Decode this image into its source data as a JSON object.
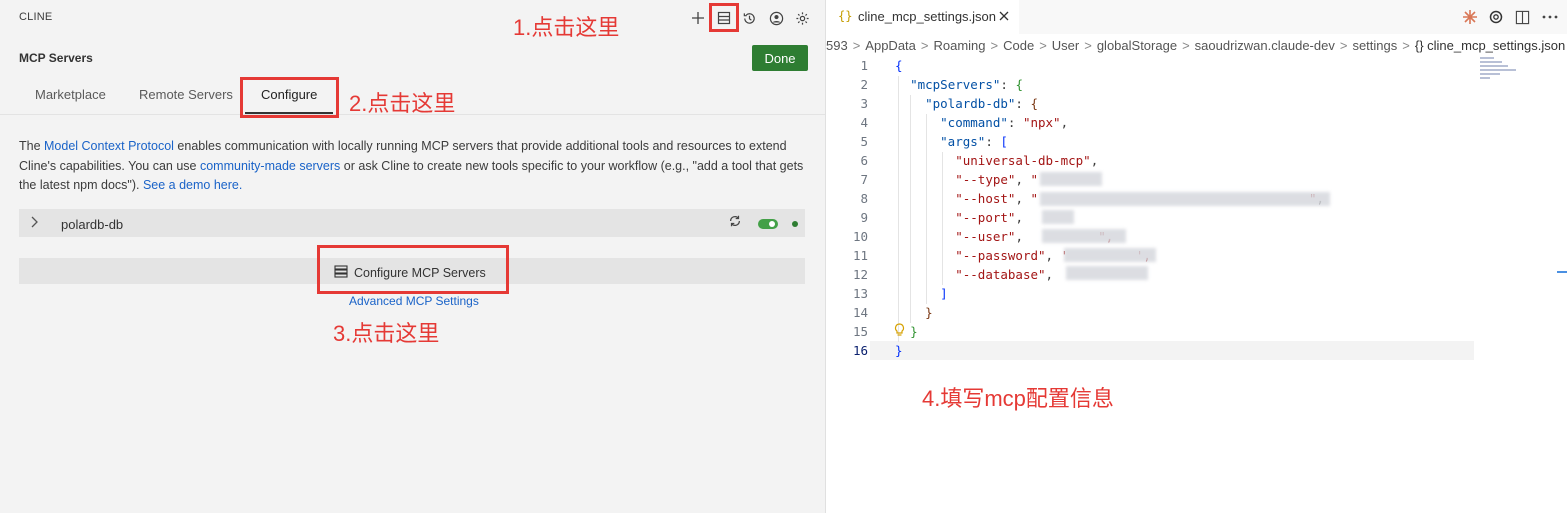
{
  "left_panel": {
    "app_title": "CLINE",
    "section_title": "MCP Servers",
    "done_label": "Done",
    "tabs": [
      {
        "label": "Marketplace"
      },
      {
        "label": "Remote Servers"
      },
      {
        "label": "Configure"
      }
    ],
    "description": {
      "p1": "The ",
      "link1": "Model Context Protocol",
      "p2": " enables communication with locally running MCP servers that provide additional tools and resources to extend Cline's capabilities. You can use ",
      "link2": "community-made servers",
      "p3": " or ask Cline to create new tools specific to your workflow (e.g., \"add a tool that gets the latest npm docs\"). ",
      "link3": "See a demo here."
    },
    "server": {
      "name": "polardb-db",
      "enabled": true
    },
    "configure_button_label": "Configure MCP Servers",
    "advanced_link": "Advanced MCP Settings",
    "toolbar_icons": [
      "plus-icon",
      "servers-icon",
      "history-icon",
      "account-icon",
      "gear-icon"
    ]
  },
  "annotations": {
    "step1": "1.点击这里",
    "step2": "2.点击这里",
    "step3": "3.点击这里",
    "step4": "4.填写mcp配置信息",
    "color": "#e53935"
  },
  "editor": {
    "tab": {
      "icon": "{}",
      "filename": "cline_mcp_settings.json"
    },
    "breadcrumbs": [
      "593",
      "AppData",
      "Roaming",
      "Code",
      "User",
      "globalStorage",
      "saoudrizwan.claude-dev",
      "settings",
      "{} cline_mcp_settings.json"
    ],
    "right_icons": [
      "claude-icon",
      "openai-icon",
      "split-editor-icon",
      "more-icon"
    ],
    "line_numbers": [
      "1",
      "2",
      "3",
      "4",
      "5",
      "6",
      "7",
      "8",
      "9",
      "10",
      "11",
      "12",
      "13",
      "14",
      "15",
      "16"
    ],
    "current_line": "16",
    "code": {
      "l1": "{",
      "l2_key": "\"mcpServers\"",
      "l3_key": "\"polardb-db\"",
      "l4_key": "\"command\"",
      "l4_val": "\"npx\"",
      "l5_key": "\"args\"",
      "l6_val": "\"universal-db-mcp\"",
      "l7_val": "\"--type\"",
      "l8_val": "\"--host\"",
      "l9_val": "\"--port\"",
      "l10_val": "\"--user\"",
      "l11_val": "\"--password\"",
      "l12_val": "\"--database\"",
      "close_bracket": "]",
      "close_brace": "}"
    }
  }
}
